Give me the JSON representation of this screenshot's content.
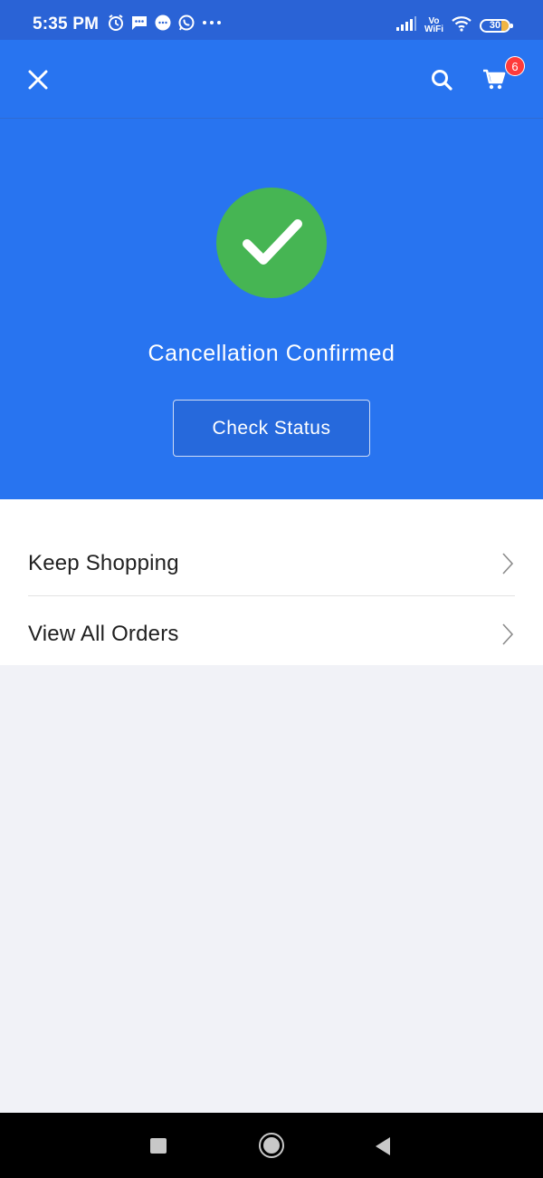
{
  "status_bar": {
    "time": "5:35 PM",
    "left_icons": [
      "alarm-icon",
      "sms-icon",
      "chat-bubble-icon",
      "whatsapp-icon",
      "more-dots-icon"
    ],
    "network_label_top": "Vo",
    "network_label_bottom": "WiFi",
    "battery_level": "30",
    "background": "#2a63d6"
  },
  "app_bar": {
    "close_icon": "close-icon",
    "search_icon": "search-icon",
    "cart_icon": "cart-icon",
    "cart_count": "6",
    "background": "#2874f0"
  },
  "hero": {
    "title": "Cancellation Confirmed",
    "button_label": "Check Status",
    "success_color": "#46b553"
  },
  "menu": {
    "items": [
      {
        "label": "Keep Shopping"
      },
      {
        "label": "View All Orders"
      }
    ]
  },
  "nav_bar": {
    "buttons": [
      "recents-button",
      "home-button",
      "back-button"
    ]
  }
}
